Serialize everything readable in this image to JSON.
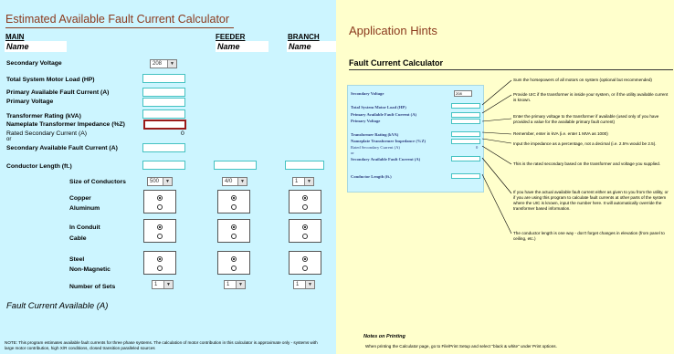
{
  "calc": {
    "title": "Estimated Available Fault Current Calculator",
    "col_main": "MAIN",
    "col_feeder": "FEEDER",
    "col_branch": "BRANCH",
    "name_label": "Name",
    "secondary_voltage": "Secondary Voltage",
    "voltage_value": "208",
    "motor_load": "Total System Motor Load (HP)",
    "primary_fault": "Primary Available Fault Current (A)",
    "primary_voltage": "Primary Voltage",
    "transformer_rating": "Transformer Rating (kVA)",
    "nameplate_impedance": "Nameplate Transformer Impedance (%Z)",
    "rated_secondary": "Rated Secondary Current (A)",
    "or_text": "or",
    "rated_value": "0",
    "secondary_fault": "Secondary Available Fault Current (A)",
    "conductor_length": "Conductor Length (ft.)",
    "size_conductors": "Size of Conductors",
    "size_main": "500",
    "size_feeder": "4/0",
    "size_branch": "1",
    "copper": "Copper",
    "aluminum": "Aluminum",
    "in_conduit": "In Conduit",
    "cable": "Cable",
    "steel": "Steel",
    "non_magnetic": "Non-Magnetic",
    "number_of_sets": "Number of Sets",
    "sets_main": "1",
    "sets_feeder": "1",
    "sets_branch": "1",
    "fault_current_available": "Fault Current Available (A)",
    "note": "NOTE: This program estimates available fault currents for three phase systems. The calculation of motor contribution in this calculator is approximate only - systems with large motor contribution, high X/R conditions, closed transition paralleled sources"
  },
  "hints": {
    "title": "Application Hints",
    "subtitle": "Fault Current Calculator",
    "panel": {
      "secondary_voltage": "Secondary Voltage",
      "voltage_value": "208",
      "motor_load": "Total System Motor Load (HP)",
      "primary_fault": "Primary Available Fault Current (A)",
      "primary_voltage": "Primary Voltage",
      "transformer_rating": "Transformer Rating (kVA)",
      "nameplate_impedance": "Nameplate Transformer Impedance (%Z)",
      "rated_secondary": "Rated Secondary Current (A)",
      "or_text": "or",
      "rated_value": "0",
      "secondary_fault": "Secondary Available Fault Current (A)",
      "conductor_length": "Conductor Length (ft.)"
    },
    "h1": "Sum the horsepowers of all motors on system (optional but recommended)",
    "h2": "Provide UIC if the transformer is inside your system, or if the utility available current is known.",
    "h3": "Enter the primary voltage to the transformer if available (used only of you have provided a value for the available primary fault current)",
    "h4": "Remember, enter in kVA (i.e. enter 1 MVA as 1000)",
    "h5": "Input the impedance as a percentage, not a decimal (i.e. 2.5% would be 2.5).",
    "h6": "This is the rated secondary based on the transformer and voltage you supplied.",
    "h7": "If you have the actual available fault current either as given to you from the utility, or if you are using this program to calculate fault currents at other parts of the system where the UIC is known, input the number here. It will automatically override the transformer based information.",
    "h8": "The conductor length is one way - don't forget changes in elevation (from panel to ceiling, etc.)",
    "notes_printing_title": "Notes on Printing",
    "notes_printing": "When printing the Calculator page, go to File/Print Setup and select \"black & white\" under Print options."
  }
}
